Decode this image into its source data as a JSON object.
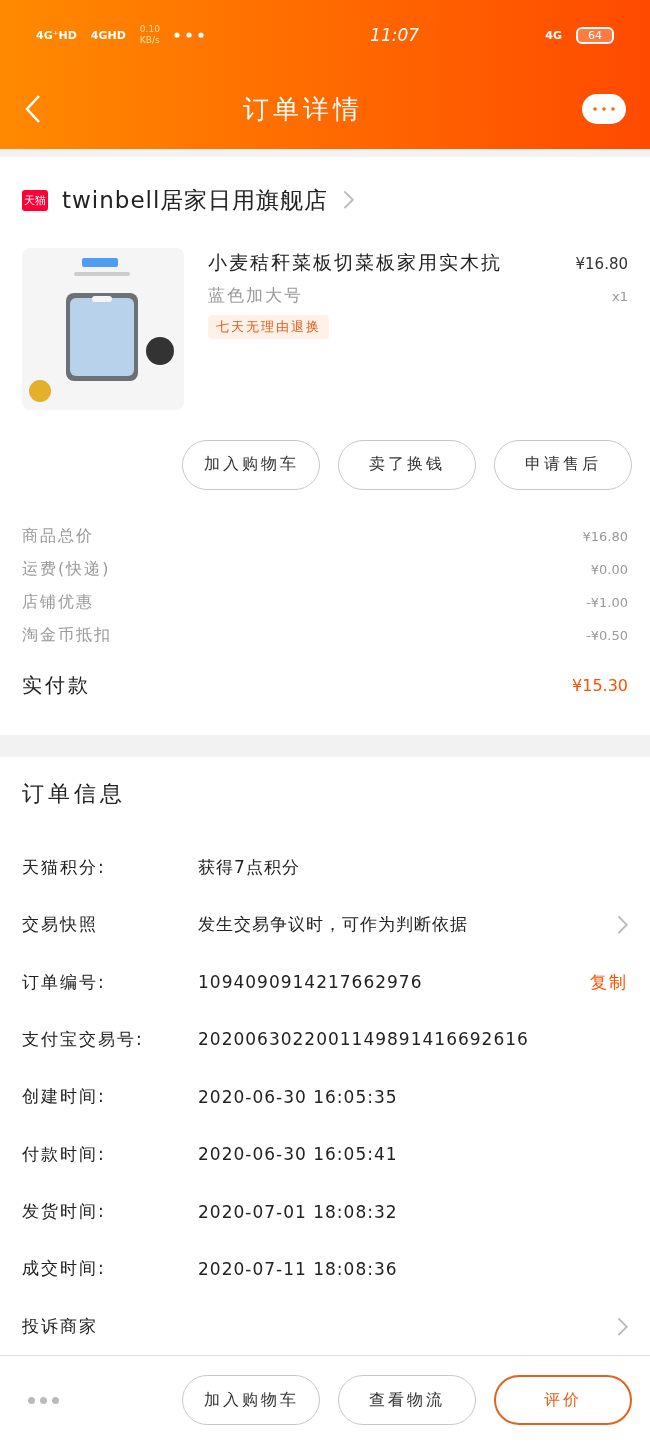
{
  "status_bar": {
    "signal_1": "4G⁺HD",
    "signal_2": "4GHD",
    "speed": "0.10",
    "speed_unit": "KB/s",
    "time": "11:07",
    "network": "4G",
    "battery": "64"
  },
  "header": {
    "title": "订单详情"
  },
  "store": {
    "badge": "天猫",
    "name": "twinbell居家日用旗舰店"
  },
  "product": {
    "title": "小麦秸秆菜板切菜板家用实木抗",
    "variant": "蓝色加大号",
    "price": "¥16.80",
    "quantity": "x1",
    "tag": "七天无理由退换"
  },
  "item_actions": [
    "加入购物车",
    "卖了换钱",
    "申请售后"
  ],
  "costs": [
    {
      "label": "商品总价",
      "value": "¥16.80"
    },
    {
      "label": "运费(快递)",
      "value": "¥0.00"
    },
    {
      "label": "店铺优惠",
      "value": "-¥1.00"
    },
    {
      "label": "淘金币抵扣",
      "value": "-¥0.50"
    }
  ],
  "total": {
    "label": "实付款",
    "value": "¥15.30"
  },
  "order_info": {
    "title": "订单信息",
    "rows": [
      {
        "label": "天猫积分:",
        "value": "获得7点积分",
        "arrow": false
      },
      {
        "label": "交易快照",
        "value": "发生交易争议时，可作为判断依据",
        "arrow": true
      },
      {
        "label": "订单编号:",
        "value": "1094090914217662976",
        "action": "复制",
        "arrow": false
      },
      {
        "label": "支付宝交易号:",
        "value": "2020063022001149891416692616",
        "arrow": false
      },
      {
        "label": "创建时间:",
        "value": "2020-06-30 16:05:35",
        "arrow": false
      },
      {
        "label": "付款时间:",
        "value": "2020-06-30 16:05:41",
        "arrow": false
      },
      {
        "label": "发货时间:",
        "value": "2020-07-01 18:08:32",
        "arrow": false
      },
      {
        "label": "成交时间:",
        "value": "2020-07-11 18:08:36",
        "arrow": false
      },
      {
        "label": "投诉商家",
        "arrow": true
      }
    ]
  },
  "bottom_bar": {
    "buttons": [
      {
        "label": "加入购物车",
        "primary": false
      },
      {
        "label": "查看物流",
        "primary": false
      },
      {
        "label": "评价",
        "primary": true
      }
    ]
  }
}
